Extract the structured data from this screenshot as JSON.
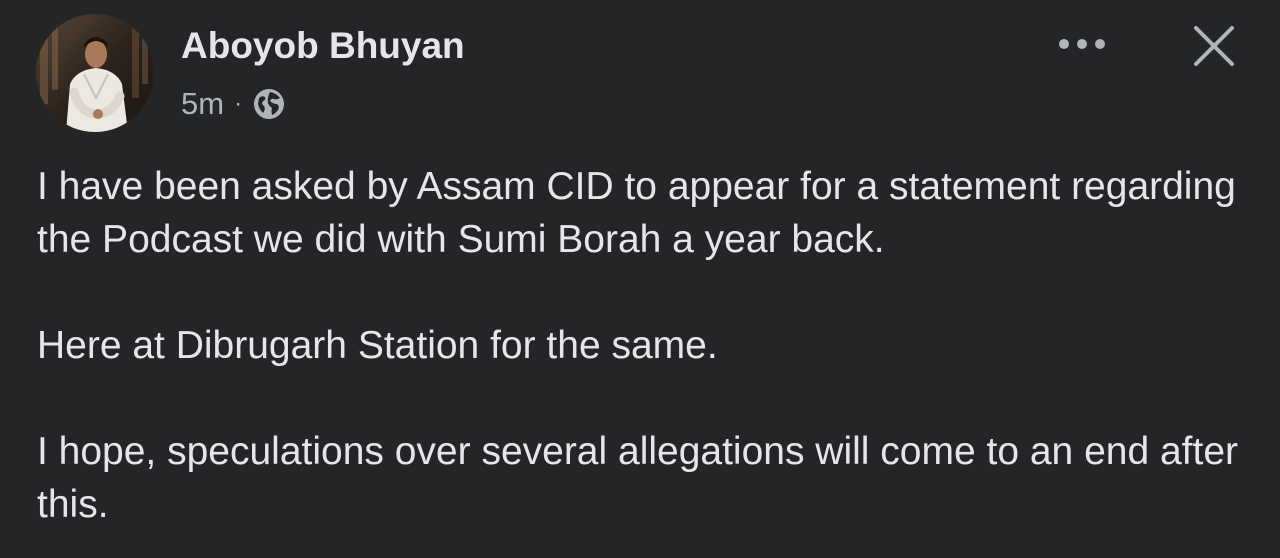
{
  "post": {
    "author": {
      "name": "Aboyob Bhuyan",
      "avatar": "profile-photo"
    },
    "meta": {
      "time": "5m",
      "separator": "·",
      "audience_icon": "globe-icon"
    },
    "actions": {
      "more_icon": "more-horizontal-icon",
      "close_icon": "close-icon"
    },
    "paragraphs": [
      "I have been asked by Assam CID to appear for a statement regarding the Podcast we did with Sumi Borah a year back.",
      "Here at Dibrugarh Station for the same.",
      "I hope, speculations over several allegations will come to an end after this."
    ]
  },
  "colors": {
    "background": "#242526",
    "primary_text": "#e4e6eb",
    "secondary_text": "#b0b3b8"
  }
}
